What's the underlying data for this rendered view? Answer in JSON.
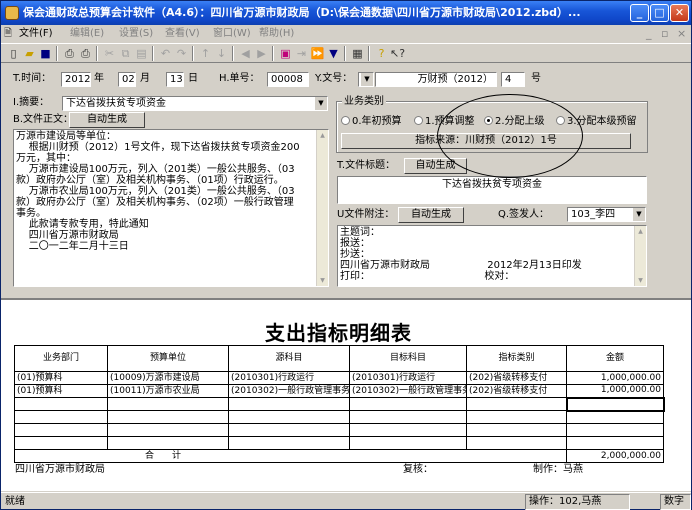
{
  "window": {
    "title": "保会通财政总预算会计软件（A4.6）：四川省万源市财政局（D:\\保会通数据\\四川省万源市财政局\\2012.zbd）..."
  },
  "menu": [
    {
      "label": "文件(F)"
    },
    {
      "label": "编辑(E)"
    },
    {
      "label": "设置(S)"
    },
    {
      "label": "查看(V)"
    },
    {
      "label": "窗口(W)"
    },
    {
      "label": "帮助(H)"
    }
  ],
  "form": {
    "time_label": "T.时间：",
    "year": "2012",
    "year_unit": "年",
    "month": "02",
    "month_unit": "月",
    "day": "13",
    "day_unit": "日",
    "bill_no_label": "H.单号：",
    "bill_no": "00008",
    "doc_no_label": "Y.文号：",
    "doc_no_text": "万财预（2012）",
    "doc_no_num": "4",
    "doc_no_unit": "号",
    "abstract_label": "I.摘要：",
    "abstract_value": "下达省拨扶贫专项资金",
    "file_body_label": "B.文件正文：",
    "auto_gen_1": "自动生成",
    "file_body_text": "万源市建设局等单位：\n    根据川财预（2012）1号文件，现下达省拨扶贫专项资金200\n万元，其中：\n    万源市建设局100万元，列入（201类）一般公共服务、（03\n款）政府办公厅（室）及相关机构事务、（01项）行政运行。\n    万源市农业局100万元，列入（201类）一般公共服务、（03\n款）政府办公厅（室）及相关机构事务、（02项）一般行政管理\n事务。\n    此款请专款专用，特此通知\n    四川省万源市财政局\n    二〇一二年二月十三日",
    "biz_type_group": "业务类别",
    "radios": [
      {
        "label": "0.年初预算",
        "checked": false
      },
      {
        "label": "1.预算调整",
        "checked": false
      },
      {
        "label": "2.分配上级",
        "checked": true
      },
      {
        "label": "3.分配本级预留",
        "checked": false
      }
    ],
    "indicator_source": "指标来源：川财预（2012）1号",
    "file_title_label": "T.文件标题：",
    "auto_gen_2": "自动生成",
    "file_title_value": "下达省拨扶贫专项资金",
    "file_attach_label": "U文件附注：",
    "auto_gen_3": "自动生成",
    "signer_label": "Q.签发人：",
    "signer_value": "103_李四",
    "attach_text": "主题词：\n报送：\n抄送：\n四川省万源市财政局                  2012年2月13日印发\n打印：                                    校对："
  },
  "report": {
    "title": "支出指标明细表",
    "columns": [
      "业务部门",
      "预算单位",
      "源科目",
      "目标科目",
      "指标类别",
      "金额"
    ],
    "rows": [
      [
        "(01)预算科",
        "(10009)万源市建设局",
        "(2010301)行政运行",
        "(2010301)行政运行",
        "(202)省级转移支付",
        "1,000,000.00"
      ],
      [
        "(01)预算科",
        "(10011)万源市农业局",
        "(2010302)一般行政管理事务",
        "(2010302)一般行政管理事务",
        "(202)省级转移支付",
        "1,000,000.00"
      ],
      [
        "",
        "",
        "",
        "",
        "",
        ""
      ],
      [
        "",
        "",
        "",
        "",
        "",
        ""
      ],
      [
        "",
        "",
        "",
        "",
        "",
        ""
      ],
      [
        "",
        "",
        "",
        "",
        "",
        ""
      ]
    ],
    "total_label": "合　　计",
    "total_value": "2,000,000.00",
    "footer_org": "四川省万源市财政局",
    "footer_review": "复核：",
    "footer_maker": "制作：马燕"
  },
  "status": {
    "ready": "就绪",
    "operator": "操作：102,马燕",
    "mode": "数字"
  }
}
